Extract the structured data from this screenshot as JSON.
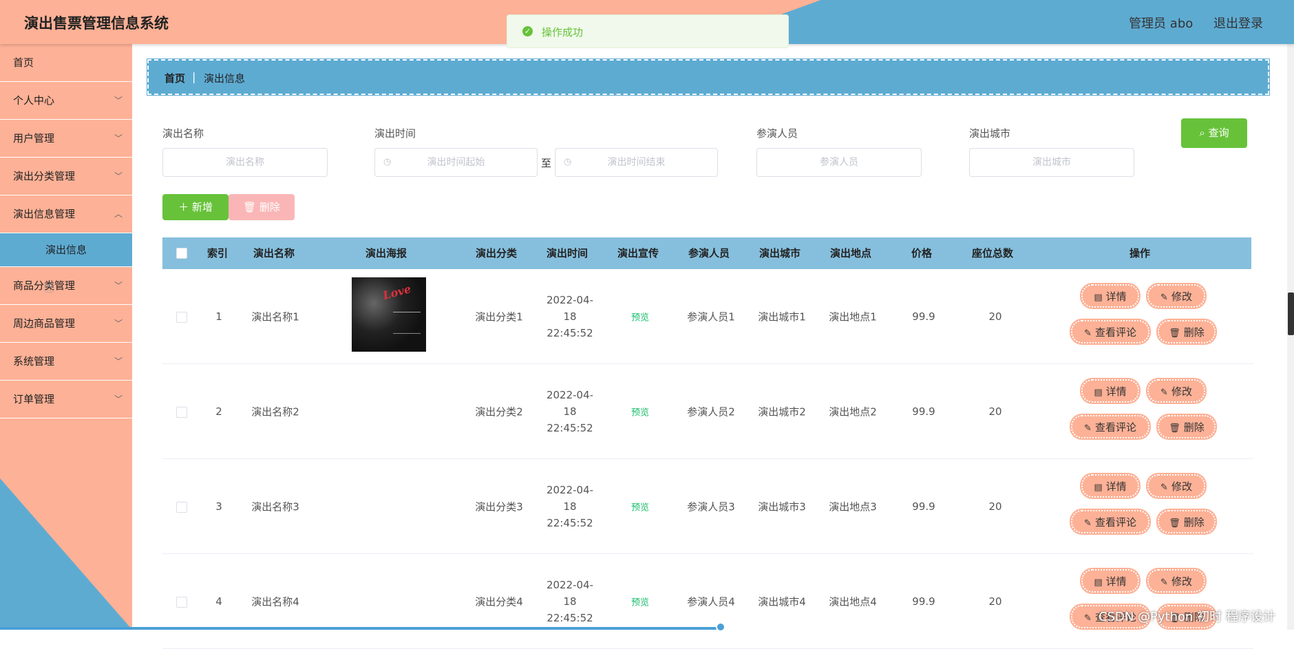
{
  "app": {
    "title": "演出售票管理信息系统",
    "user": "管理员 abo",
    "logout": "退出登录"
  },
  "toast": {
    "message": "操作成功"
  },
  "sidebar": {
    "items": [
      {
        "label": "首页"
      },
      {
        "label": "个人中心"
      },
      {
        "label": "用户管理"
      },
      {
        "label": "演出分类管理"
      },
      {
        "label": "演出信息管理"
      },
      {
        "label": "商品分类管理"
      },
      {
        "label": "周边商品管理"
      },
      {
        "label": "系统管理"
      },
      {
        "label": "订单管理"
      }
    ],
    "active_sub": "演出信息"
  },
  "breadcrumb": {
    "home": "首页",
    "current": "演出信息"
  },
  "search": {
    "name_label": "演出名称",
    "name_placeholder": "演出名称",
    "time_label": "演出时间",
    "time_start_placeholder": "演出时间起始",
    "time_to": "至",
    "time_end_placeholder": "演出时间结束",
    "performer_label": "参演人员",
    "performer_placeholder": "参演人员",
    "city_label": "演出城市",
    "city_placeholder": "演出城市",
    "query_button": "查询"
  },
  "actions": {
    "add": "新增",
    "delete": "删除"
  },
  "table": {
    "columns": [
      "索引",
      "演出名称",
      "演出海报",
      "演出分类",
      "演出时间",
      "演出宣传",
      "参演人员",
      "演出城市",
      "演出地点",
      "价格",
      "座位总数",
      "操作"
    ],
    "rows": [
      {
        "index": "1",
        "name": "演出名称1",
        "category": "演出分类1",
        "time": "2022-04-18 22:45:52",
        "promo": "预览",
        "performer": "参演人员1",
        "city": "演出城市1",
        "venue": "演出地点1",
        "price": "99.9",
        "seats": "20",
        "poster_text": "Love"
      },
      {
        "index": "2",
        "name": "演出名称2",
        "category": "演出分类2",
        "time": "2022-04-18 22:45:52",
        "promo": "预览",
        "performer": "参演人员2",
        "city": "演出城市2",
        "venue": "演出地点2",
        "price": "99.9",
        "seats": "20"
      },
      {
        "index": "3",
        "name": "演出名称3",
        "category": "演出分类3",
        "time": "2022-04-18 22:45:52",
        "promo": "预览",
        "performer": "参演人员3",
        "city": "演出城市3",
        "venue": "演出地点3",
        "price": "99.9",
        "seats": "20"
      },
      {
        "index": "4",
        "name": "演出名称4",
        "category": "演出分类4",
        "time": "2022-04-18 22:45:52",
        "promo": "预览",
        "performer": "参演人员4",
        "city": "演出城市4",
        "venue": "演出地点4",
        "price": "99.9",
        "seats": "20"
      }
    ],
    "ops": {
      "detail": "详情",
      "edit": "修改",
      "comments": "查看评论",
      "delete": "删除"
    }
  },
  "watermark": "CSDN @Python 初时 程序设计"
}
